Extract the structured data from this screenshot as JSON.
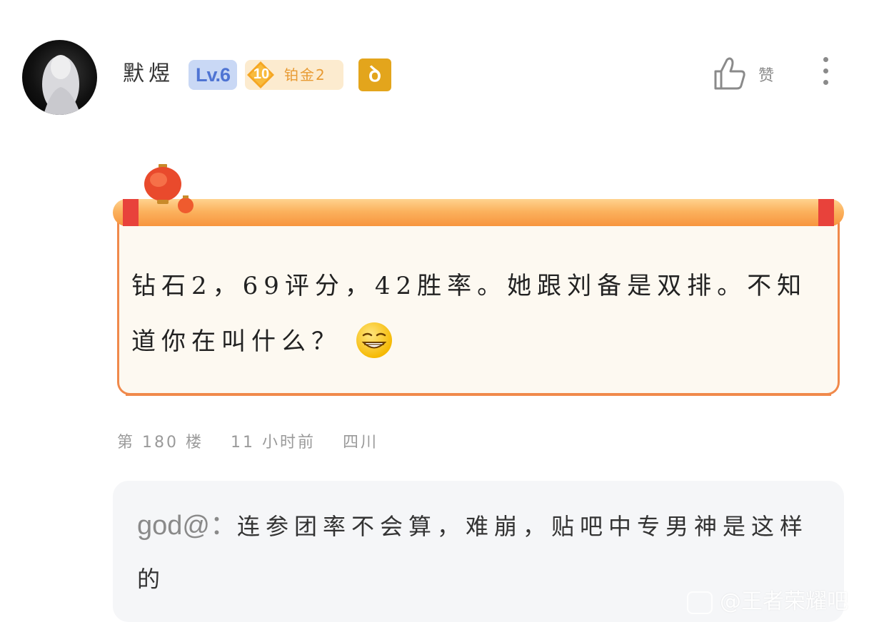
{
  "post": {
    "username": "默煜",
    "level_badge": "Lv.6",
    "rank_badge": {
      "number": "10",
      "name": "铂金2"
    },
    "zodiac_badge": "ꝺ",
    "like_label": "赞",
    "content": "钻石2，69评分，42胜率。她跟刘备是双排。不知道你在叫什么？",
    "emoji": "grin-emoji"
  },
  "meta": {
    "floor": "第 180 楼",
    "time": "11 小时前",
    "location": "四川"
  },
  "reply": {
    "user": "god@：",
    "text": "连参团率不会算，难崩，贴吧中专男神是这样的"
  },
  "watermark": "@王者荣耀吧",
  "colors": {
    "accent_orange": "#f0894b",
    "level_blue": "#4f74d3",
    "rank_gold": "#e89a32",
    "zodiac_gold": "#e3a51c"
  }
}
